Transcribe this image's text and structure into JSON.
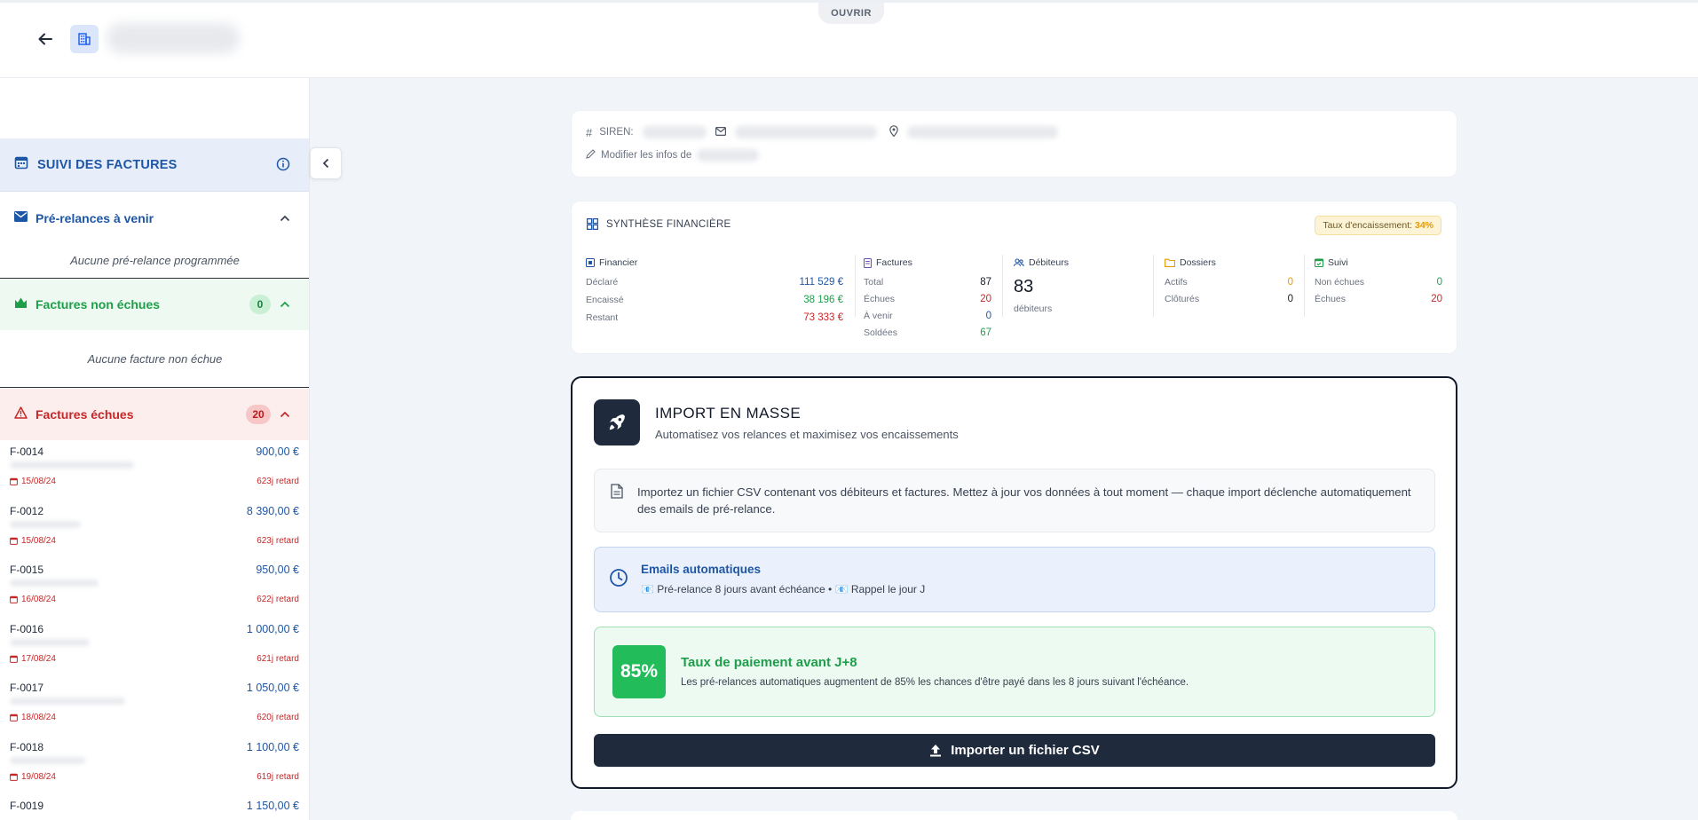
{
  "topbar": {
    "ouvrir_label": "OUVRIR"
  },
  "sidebar": {
    "header_title": "SUIVI DES FACTURES",
    "prerelances": {
      "label": "Pré-relances à venir",
      "empty": "Aucune pré-relance programmée"
    },
    "non_echues": {
      "label": "Factures non échues",
      "count": "0",
      "empty": "Aucune facture non échue"
    },
    "echues": {
      "label": "Factures échues",
      "count": "20"
    },
    "invoices": [
      {
        "id": "F-0014",
        "amount": "900,00 €",
        "date": "15/08/24",
        "retard": "623j retard"
      },
      {
        "id": "F-0012",
        "amount": "8 390,00 €",
        "date": "15/08/24",
        "retard": "623j retard"
      },
      {
        "id": "F-0015",
        "amount": "950,00 €",
        "date": "16/08/24",
        "retard": "622j retard"
      },
      {
        "id": "F-0016",
        "amount": "1 000,00 €",
        "date": "17/08/24",
        "retard": "621j retard"
      },
      {
        "id": "F-0017",
        "amount": "1 050,00 €",
        "date": "18/08/24",
        "retard": "620j retard"
      },
      {
        "id": "F-0018",
        "amount": "1 100,00 €",
        "date": "19/08/24",
        "retard": "619j retard"
      },
      {
        "id": "F-0019",
        "amount": "1 150,00 €",
        "date": "",
        "retard": ""
      }
    ]
  },
  "info": {
    "siren_label": "SIREN:",
    "edit_label": "Modifier les infos de"
  },
  "synthese": {
    "title": "SYNTHÈSE FINANCIÈRE",
    "taux_label": "Taux d'encaissement:",
    "taux_value": "34%",
    "financier": {
      "title": "Financier",
      "rows": [
        {
          "k": "Déclaré",
          "v": "111 529 €",
          "color": "#1e56a6"
        },
        {
          "k": "Encaissé",
          "v": "38 196 €",
          "color": "#1e9e4a"
        },
        {
          "k": "Restant",
          "v": "73 333 €",
          "color": "#c62828"
        }
      ]
    },
    "factures": {
      "title": "Factures",
      "rows": [
        {
          "k": "Total",
          "v": "87",
          "color": "#111827"
        },
        {
          "k": "Échues",
          "v": "20",
          "color": "#c62828"
        },
        {
          "k": "À venir",
          "v": "0",
          "color": "#1e56a6"
        },
        {
          "k": "Soldées",
          "v": "67",
          "color": "#1e9e4a"
        }
      ]
    },
    "debiteurs": {
      "title": "Débiteurs",
      "value": "83",
      "sub": "débiteurs"
    },
    "dossiers": {
      "title": "Dossiers",
      "rows": [
        {
          "k": "Actifs",
          "v": "0",
          "color": "#e39a09"
        },
        {
          "k": "Clôturés",
          "v": "0",
          "color": "#111827"
        }
      ]
    },
    "suivi": {
      "title": "Suivi",
      "rows": [
        {
          "k": "Non échues",
          "v": "0",
          "color": "#1e9e4a"
        },
        {
          "k": "Échues",
          "v": "20",
          "color": "#c62828"
        }
      ]
    }
  },
  "import": {
    "title": "IMPORT EN MASSE",
    "subtitle": "Automatisez vos relances et maximisez vos encaissements",
    "description": "Importez un fichier CSV contenant vos débiteurs et factures. Mettez à jour vos données à tout moment — chaque import déclenche automatiquement des emails de pré-relance.",
    "emails_title": "Emails automatiques",
    "emails_detail": "📧 Pré-relance 8 jours avant échéance  •  📧 Rappel le jour J",
    "pay_pct": "85%",
    "pay_title": "Taux de paiement avant J+8",
    "pay_detail": "Les pré-relances automatiques augmentent de 85% les chances d'être payé dans les 8 jours suivant l'échéance.",
    "button": "Importer un fichier CSV"
  }
}
